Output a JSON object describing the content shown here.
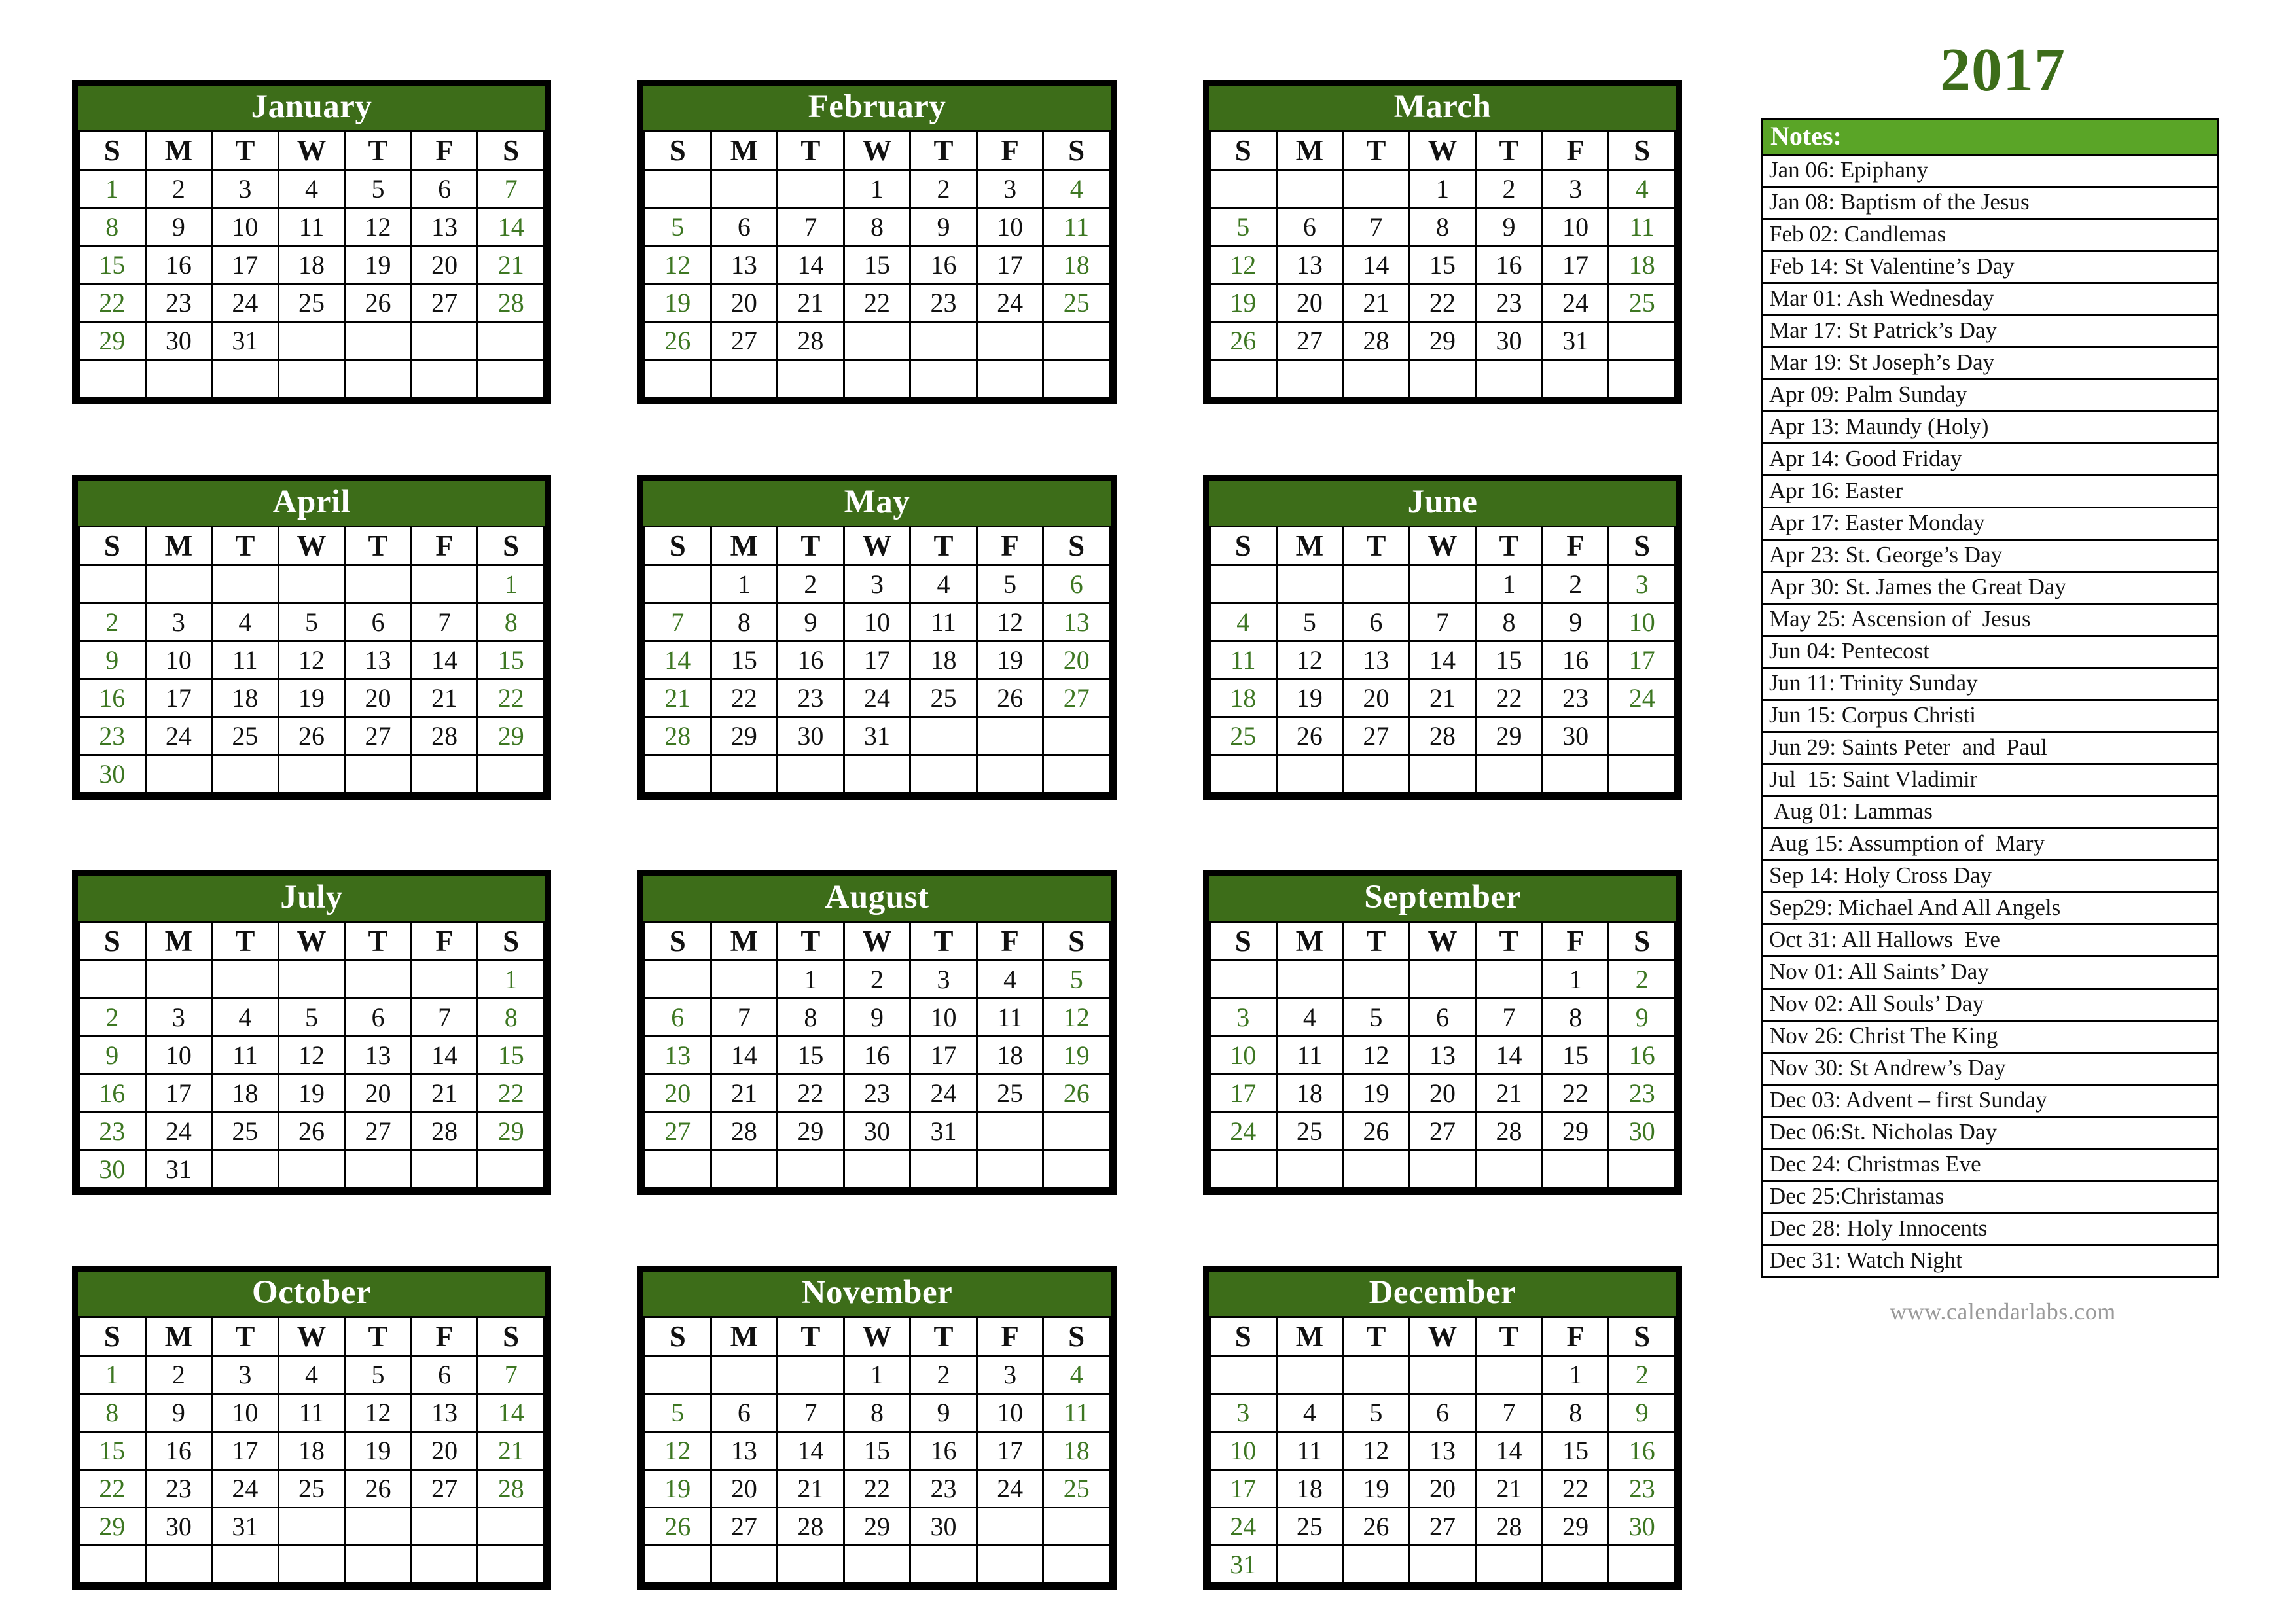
{
  "year_title": "2017",
  "footer": "www.calendarlabs.com",
  "colors": {
    "month_header_green": "#3d6d19",
    "notes_header_green": "#5aa527",
    "weekend_green": "#3d7722",
    "weekday_black": "#111111",
    "footer_gray": "#9a9a9a"
  },
  "dow": [
    "S",
    "M",
    "T",
    "W",
    "T",
    "F",
    "S"
  ],
  "notes_header": "Notes:",
  "notes": [
    "Jan 06: Epiphany",
    "Jan 08: Baptism of the Jesus",
    "Feb 02: Candlemas",
    "Feb 14: St Valentine’s Day",
    "Mar 01: Ash Wednesday",
    "Mar 17: St Patrick’s Day",
    "Mar 19: St Joseph’s Day",
    "Apr 09: Palm Sunday",
    "Apr 13: Maundy (Holy)",
    "Apr 14: Good Friday",
    "Apr 16: Easter",
    "Apr 17: Easter Monday",
    "Apr 23: St. George’s Day",
    "Apr 30: St. James the Great Day",
    "May 25: Ascension of  Jesus",
    "Jun 04: Pentecost",
    "Jun 11: Trinity Sunday",
    "Jun 15: Corpus Christi",
    "Jun 29: Saints Peter  and  Paul",
    "Jul  15: Saint Vladimir",
    " Aug 01: Lammas",
    "Aug 15: Assumption of  Mary",
    "Sep 14: Holy Cross Day",
    "Sep29: Michael And All Angels",
    "Oct 31: All Hallows  Eve",
    "Nov 01: All Saints’ Day",
    "Nov 02: All Souls’ Day",
    "Nov 26: Christ The King",
    "Nov 30: St Andrew’s Day",
    "Dec 03: Advent – first Sunday",
    "Dec 06:St. Nicholas Day",
    "Dec 24: Christmas Eve",
    "Dec 25:Christamas",
    "Dec 28: Holy Innocents",
    "Dec 31: Watch Night"
  ],
  "months": [
    {
      "name": "January",
      "weeks": [
        [
          "1",
          "2",
          "3",
          "4",
          "5",
          "6",
          "7"
        ],
        [
          "8",
          "9",
          "10",
          "11",
          "12",
          "13",
          "14"
        ],
        [
          "15",
          "16",
          "17",
          "18",
          "19",
          "20",
          "21"
        ],
        [
          "22",
          "23",
          "24",
          "25",
          "26",
          "27",
          "28"
        ],
        [
          "29",
          "30",
          "31",
          "",
          "",
          "",
          ""
        ],
        [
          "",
          "",
          "",
          "",
          "",
          "",
          ""
        ]
      ]
    },
    {
      "name": "February",
      "weeks": [
        [
          "",
          "",
          "",
          "1",
          "2",
          "3",
          "4"
        ],
        [
          "5",
          "6",
          "7",
          "8",
          "9",
          "10",
          "11"
        ],
        [
          "12",
          "13",
          "14",
          "15",
          "16",
          "17",
          "18"
        ],
        [
          "19",
          "20",
          "21",
          "22",
          "23",
          "24",
          "25"
        ],
        [
          "26",
          "27",
          "28",
          "",
          "",
          "",
          ""
        ],
        [
          "",
          "",
          "",
          "",
          "",
          "",
          ""
        ]
      ]
    },
    {
      "name": "March",
      "weeks": [
        [
          "",
          "",
          "",
          "1",
          "2",
          "3",
          "4"
        ],
        [
          "5",
          "6",
          "7",
          "8",
          "9",
          "10",
          "11"
        ],
        [
          "12",
          "13",
          "14",
          "15",
          "16",
          "17",
          "18"
        ],
        [
          "19",
          "20",
          "21",
          "22",
          "23",
          "24",
          "25"
        ],
        [
          "26",
          "27",
          "28",
          "29",
          "30",
          "31",
          ""
        ],
        [
          "",
          "",
          "",
          "",
          "",
          "",
          ""
        ]
      ]
    },
    {
      "name": "April",
      "weeks": [
        [
          "",
          "",
          "",
          "",
          "",
          "",
          "1"
        ],
        [
          "2",
          "3",
          "4",
          "5",
          "6",
          "7",
          "8"
        ],
        [
          "9",
          "10",
          "11",
          "12",
          "13",
          "14",
          "15"
        ],
        [
          "16",
          "17",
          "18",
          "19",
          "20",
          "21",
          "22"
        ],
        [
          "23",
          "24",
          "25",
          "26",
          "27",
          "28",
          "29"
        ],
        [
          "30",
          "",
          "",
          "",
          "",
          "",
          ""
        ]
      ]
    },
    {
      "name": "May",
      "weeks": [
        [
          "",
          "1",
          "2",
          "3",
          "4",
          "5",
          "6"
        ],
        [
          "7",
          "8",
          "9",
          "10",
          "11",
          "12",
          "13"
        ],
        [
          "14",
          "15",
          "16",
          "17",
          "18",
          "19",
          "20"
        ],
        [
          "21",
          "22",
          "23",
          "24",
          "25",
          "26",
          "27"
        ],
        [
          "28",
          "29",
          "30",
          "31",
          "",
          "",
          ""
        ],
        [
          "",
          "",
          "",
          "",
          "",
          "",
          ""
        ]
      ]
    },
    {
      "name": "June",
      "weeks": [
        [
          "",
          "",
          "",
          "",
          "1",
          "2",
          "3"
        ],
        [
          "4",
          "5",
          "6",
          "7",
          "8",
          "9",
          "10"
        ],
        [
          "11",
          "12",
          "13",
          "14",
          "15",
          "16",
          "17"
        ],
        [
          "18",
          "19",
          "20",
          "21",
          "22",
          "23",
          "24"
        ],
        [
          "25",
          "26",
          "27",
          "28",
          "29",
          "30",
          ""
        ],
        [
          "",
          "",
          "",
          "",
          "",
          "",
          ""
        ]
      ]
    },
    {
      "name": "July",
      "weeks": [
        [
          "",
          "",
          "",
          "",
          "",
          "",
          "1"
        ],
        [
          "2",
          "3",
          "4",
          "5",
          "6",
          "7",
          "8"
        ],
        [
          "9",
          "10",
          "11",
          "12",
          "13",
          "14",
          "15"
        ],
        [
          "16",
          "17",
          "18",
          "19",
          "20",
          "21",
          "22"
        ],
        [
          "23",
          "24",
          "25",
          "26",
          "27",
          "28",
          "29"
        ],
        [
          "30",
          "31",
          "",
          "",
          "",
          "",
          ""
        ]
      ]
    },
    {
      "name": "August",
      "weeks": [
        [
          "",
          "",
          "1",
          "2",
          "3",
          "4",
          "5"
        ],
        [
          "6",
          "7",
          "8",
          "9",
          "10",
          "11",
          "12"
        ],
        [
          "13",
          "14",
          "15",
          "16",
          "17",
          "18",
          "19"
        ],
        [
          "20",
          "21",
          "22",
          "23",
          "24",
          "25",
          "26"
        ],
        [
          "27",
          "28",
          "29",
          "30",
          "31",
          "",
          ""
        ],
        [
          "",
          "",
          "",
          "",
          "",
          "",
          ""
        ]
      ]
    },
    {
      "name": "September",
      "weeks": [
        [
          "",
          "",
          "",
          "",
          "",
          "1",
          "2"
        ],
        [
          "3",
          "4",
          "5",
          "6",
          "7",
          "8",
          "9"
        ],
        [
          "10",
          "11",
          "12",
          "13",
          "14",
          "15",
          "16"
        ],
        [
          "17",
          "18",
          "19",
          "20",
          "21",
          "22",
          "23"
        ],
        [
          "24",
          "25",
          "26",
          "27",
          "28",
          "29",
          "30"
        ],
        [
          "",
          "",
          "",
          "",
          "",
          "",
          ""
        ]
      ]
    },
    {
      "name": "October",
      "weeks": [
        [
          "1",
          "2",
          "3",
          "4",
          "5",
          "6",
          "7"
        ],
        [
          "8",
          "9",
          "10",
          "11",
          "12",
          "13",
          "14"
        ],
        [
          "15",
          "16",
          "17",
          "18",
          "19",
          "20",
          "21"
        ],
        [
          "22",
          "23",
          "24",
          "25",
          "26",
          "27",
          "28"
        ],
        [
          "29",
          "30",
          "31",
          "",
          "",
          "",
          ""
        ],
        [
          "",
          "",
          "",
          "",
          "",
          "",
          ""
        ]
      ]
    },
    {
      "name": "November",
      "weeks": [
        [
          "",
          "",
          "",
          "1",
          "2",
          "3",
          "4"
        ],
        [
          "5",
          "6",
          "7",
          "8",
          "9",
          "10",
          "11"
        ],
        [
          "12",
          "13",
          "14",
          "15",
          "16",
          "17",
          "18"
        ],
        [
          "19",
          "20",
          "21",
          "22",
          "23",
          "24",
          "25"
        ],
        [
          "26",
          "27",
          "28",
          "29",
          "30",
          "",
          ""
        ],
        [
          "",
          "",
          "",
          "",
          "",
          "",
          ""
        ]
      ]
    },
    {
      "name": "December",
      "weeks": [
        [
          "",
          "",
          "",
          "",
          "",
          "1",
          "2"
        ],
        [
          "3",
          "4",
          "5",
          "6",
          "7",
          "8",
          "9"
        ],
        [
          "10",
          "11",
          "12",
          "13",
          "14",
          "15",
          "16"
        ],
        [
          "17",
          "18",
          "19",
          "20",
          "21",
          "22",
          "23"
        ],
        [
          "24",
          "25",
          "26",
          "27",
          "28",
          "29",
          "30"
        ],
        [
          "31",
          "",
          "",
          "",
          "",
          "",
          ""
        ]
      ]
    }
  ]
}
